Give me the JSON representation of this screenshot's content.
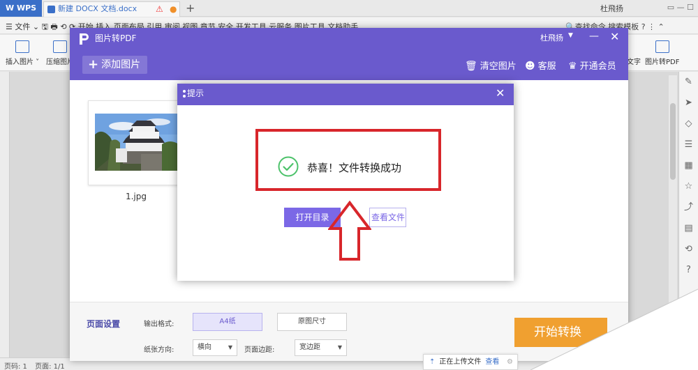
{
  "wps": {
    "logo": "W WPS",
    "doc_tab": "新建 DOCX 文档.docx",
    "doc_warn": "⚠",
    "doc_dot": "●",
    "new_tab": "+",
    "user": "杜飛扬",
    "win_ctrl": "▭  —  ☐",
    "menu_left": "☰ 文件 ⌄   🖫  🖶  ⟲  ⟳     开始     插入     页面布局     引用     审阅     视图     章节     安全     开发工具     云服务     图片工具     文档助手",
    "menu_right": "🔍查找命令   搜索模板   ?  ⋮  ⌃",
    "ribbon": {
      "insert_image": "插入图片 ˅",
      "compress_image": "压缩图片",
      "to_text": "文字",
      "to_pdf": "图片转PDF"
    },
    "status": {
      "page_code": "页码: 1",
      "page": "页面: 1/1"
    },
    "right_tools": [
      "✎",
      "➤",
      "◇",
      "☰",
      "▦",
      "☆",
      "⤴",
      "▤",
      "⟲",
      "?"
    ]
  },
  "upload": {
    "arrow": "⇡",
    "text": "正在上传文件",
    "link": "查看",
    "gear": "⚙"
  },
  "pdf_app": {
    "title": "图片转PDF",
    "user": "杜飛扬",
    "user_caret": "▼",
    "minimize": "—",
    "close": "✕",
    "add_image": {
      "plus": "+",
      "label": "添加图片"
    },
    "actions": [
      {
        "icon": "🗑",
        "label": "清空图片"
      },
      {
        "icon": "☻",
        "label": "客服"
      },
      {
        "icon": "♛",
        "label": "开通会员"
      }
    ],
    "files": [
      {
        "name": "1.jpg"
      }
    ],
    "settings": {
      "title": "页面设置",
      "output_format_label": "输出格式:",
      "format_options": [
        "A4纸",
        "原图尺寸"
      ],
      "orientation_label": "纸张方向:",
      "orientation_value": "横向",
      "margin_label": "页面边距:",
      "margin_value": "宽边距",
      "start_button": "开始转换"
    }
  },
  "dialog": {
    "title": "提示",
    "close": "✕",
    "message": "恭喜！文件转换成功",
    "open_dir": "打开目录",
    "view_file": "查看文件"
  },
  "colors": {
    "brand_purple": "#6a5acd",
    "button_purple": "#7b68e6",
    "success_green": "#4cc26a",
    "annotation_red": "#d8262b",
    "start_orange": "#f0a030",
    "wps_blue": "#3a6fc8"
  }
}
